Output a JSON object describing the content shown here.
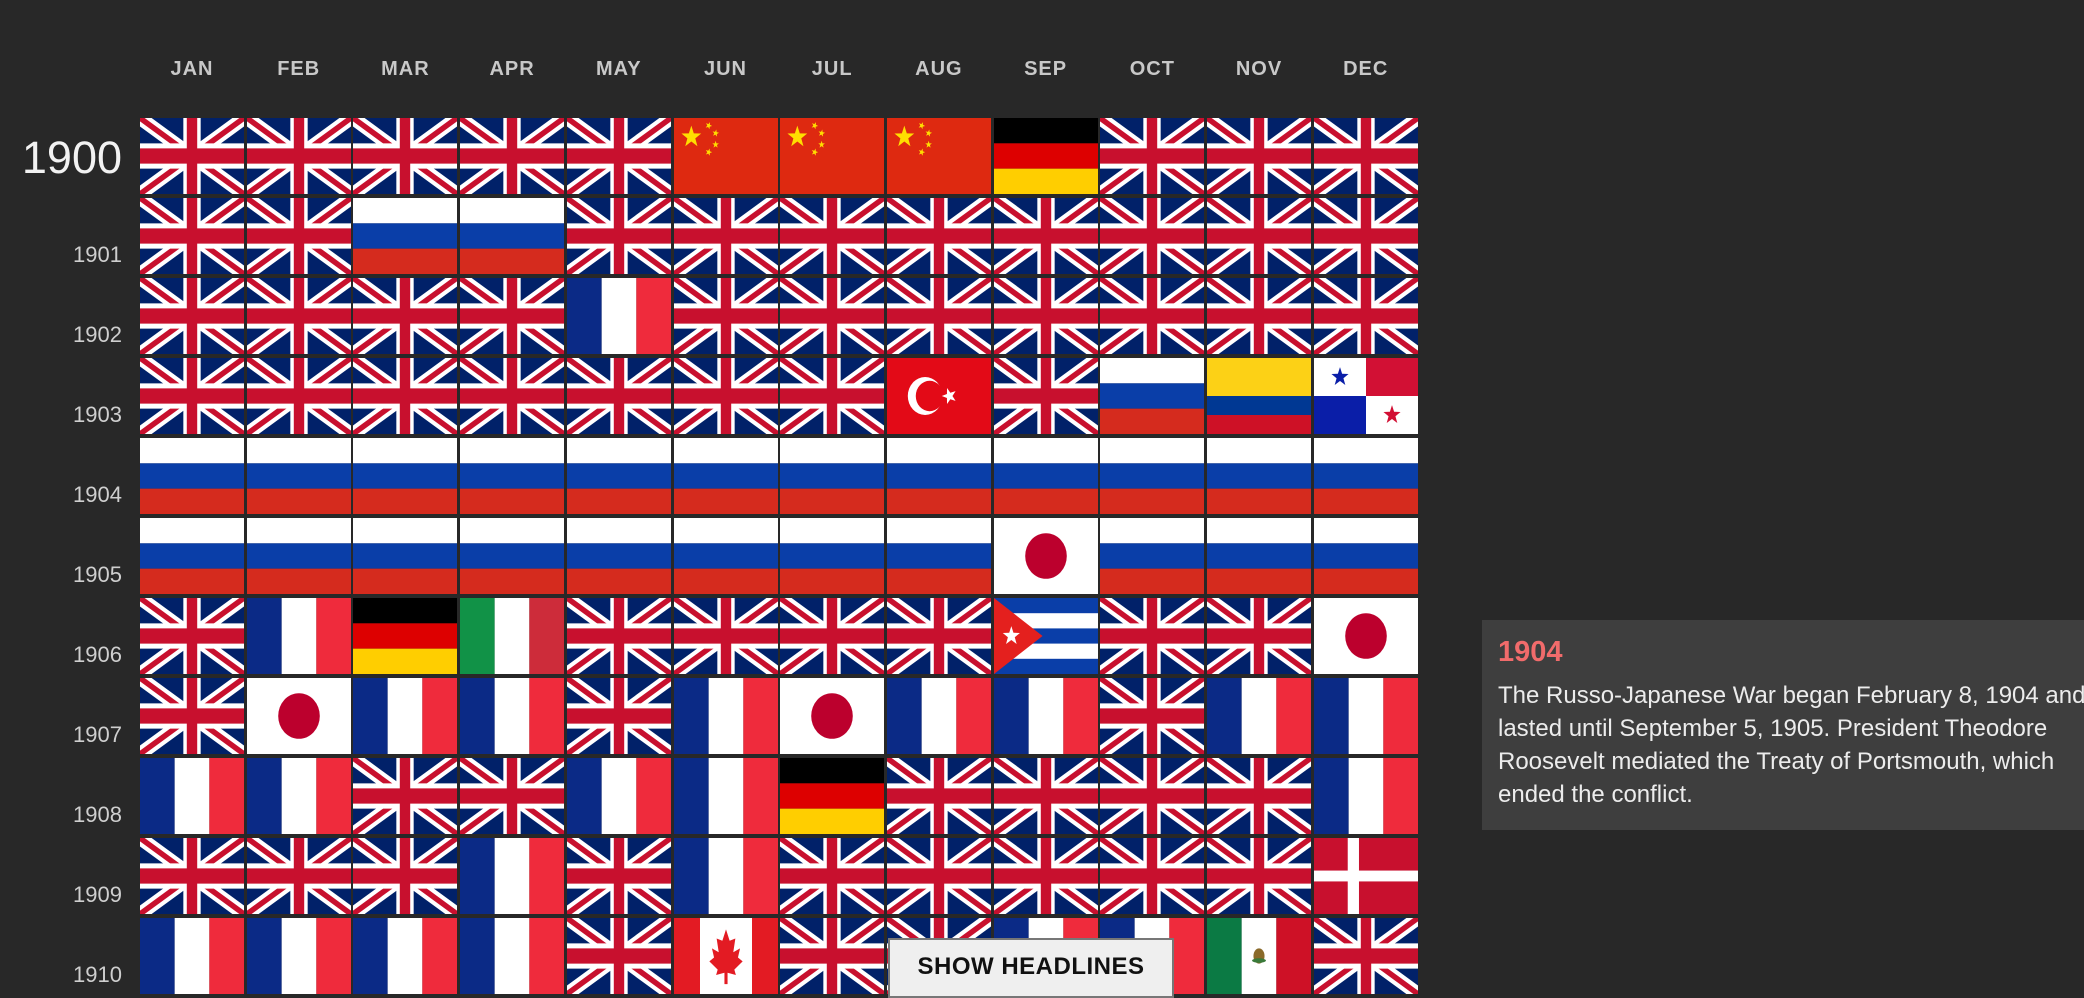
{
  "months": [
    "JAN",
    "FEB",
    "MAR",
    "APR",
    "MAY",
    "JUN",
    "JUL",
    "AUG",
    "SEP",
    "OCT",
    "NOV",
    "DEC"
  ],
  "years": [
    "1900",
    "1901",
    "1902",
    "1903",
    "1904",
    "1905",
    "1906",
    "1907",
    "1908",
    "1909",
    "1910"
  ],
  "flags": [
    [
      "uk",
      "uk",
      "uk",
      "uk",
      "uk",
      "china",
      "china",
      "china",
      "germany",
      "uk",
      "uk",
      "uk"
    ],
    [
      "uk",
      "uk",
      "russia",
      "russia",
      "uk",
      "uk",
      "uk",
      "uk",
      "uk",
      "uk",
      "uk",
      "uk"
    ],
    [
      "uk",
      "uk",
      "uk",
      "uk",
      "france",
      "uk",
      "uk",
      "uk",
      "uk",
      "uk",
      "uk",
      "uk"
    ],
    [
      "uk",
      "uk",
      "uk",
      "uk",
      "uk",
      "uk",
      "uk",
      "turkey",
      "uk",
      "russia",
      "colombia",
      "panama"
    ],
    [
      "russia",
      "russia",
      "russia",
      "russia",
      "russia",
      "russia",
      "russia",
      "russia",
      "russia",
      "russia",
      "russia",
      "russia"
    ],
    [
      "russia",
      "russia",
      "russia",
      "russia",
      "russia",
      "russia",
      "russia",
      "russia",
      "japan",
      "russia",
      "russia",
      "russia"
    ],
    [
      "uk",
      "france",
      "germany",
      "italy",
      "uk",
      "uk",
      "uk",
      "uk",
      "cuba",
      "uk",
      "uk",
      "japan"
    ],
    [
      "uk",
      "japan",
      "france",
      "france",
      "uk",
      "france",
      "japan",
      "france",
      "france",
      "uk",
      "france",
      "france"
    ],
    [
      "france",
      "france",
      "uk",
      "uk",
      "france",
      "france",
      "germany",
      "uk",
      "uk",
      "uk",
      "uk",
      "france"
    ],
    [
      "uk",
      "uk",
      "uk",
      "france",
      "uk",
      "france",
      "uk",
      "uk",
      "uk",
      "uk",
      "uk",
      "denmark"
    ],
    [
      "france",
      "france",
      "france",
      "france",
      "uk",
      "canada",
      "uk",
      "uk",
      "france",
      "france",
      "mexico",
      "uk"
    ]
  ],
  "info": {
    "year": "1904",
    "lines": [
      "The Russo-Japanese War began February 8, 1904 and",
      "lasted until September 5, 1905. President Theodore",
      "Roosevelt mediated the Treaty of Portsmouth, which",
      "ended the conflict."
    ]
  },
  "button": {
    "label": "SHOW HEADLINES"
  },
  "colors": {
    "background": "#282828",
    "info_panel": "#3e3e3e",
    "info_year": "#f16b6b"
  }
}
